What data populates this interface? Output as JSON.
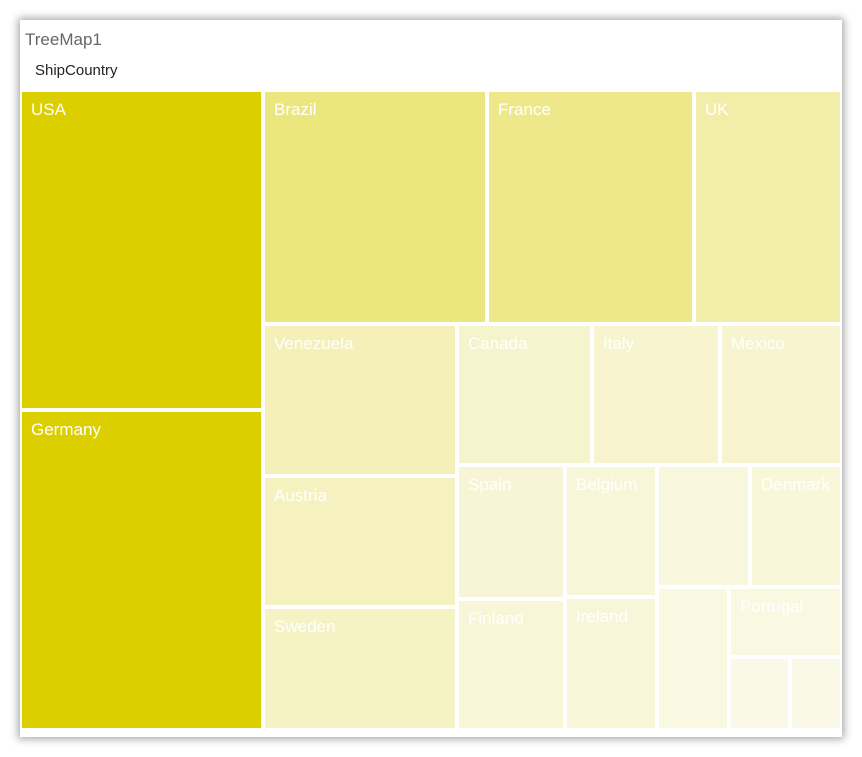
{
  "visual": {
    "title": "TreeMap1",
    "group_field": "ShipCountry"
  },
  "colors": {
    "base": "#dccf00",
    "tile_border": "#ffffff",
    "label": "#ffffff"
  },
  "chart_data": {
    "type": "treemap",
    "title": "TreeMap1",
    "group_by": "ShipCountry",
    "color_scale": "saturation by value (darkest = largest)",
    "nodes": [
      {
        "label": "USA",
        "value": 122
      },
      {
        "label": "Germany",
        "value": 122
      },
      {
        "label": "Brazil",
        "value": 83
      },
      {
        "label": "France",
        "value": 77
      },
      {
        "label": "UK",
        "value": 56
      },
      {
        "label": "Venezuela",
        "value": 46
      },
      {
        "label": "Austria",
        "value": 40
      },
      {
        "label": "Sweden",
        "value": 37
      },
      {
        "label": "Canada",
        "value": 30
      },
      {
        "label": "Italy",
        "value": 28
      },
      {
        "label": "Mexico",
        "value": 28
      },
      {
        "label": "Spain",
        "value": 23
      },
      {
        "label": "Finland",
        "value": 22
      },
      {
        "label": "Belgium",
        "value": 19
      },
      {
        "label": "Ireland",
        "value": 19
      },
      {
        "label": "",
        "value": 16
      },
      {
        "label": "Denmark",
        "value": 18
      },
      {
        "label": "",
        "value": 13
      },
      {
        "label": "Portugal",
        "value": 13
      },
      {
        "label": "",
        "value": 7
      },
      {
        "label": "",
        "value": 6
      }
    ]
  }
}
